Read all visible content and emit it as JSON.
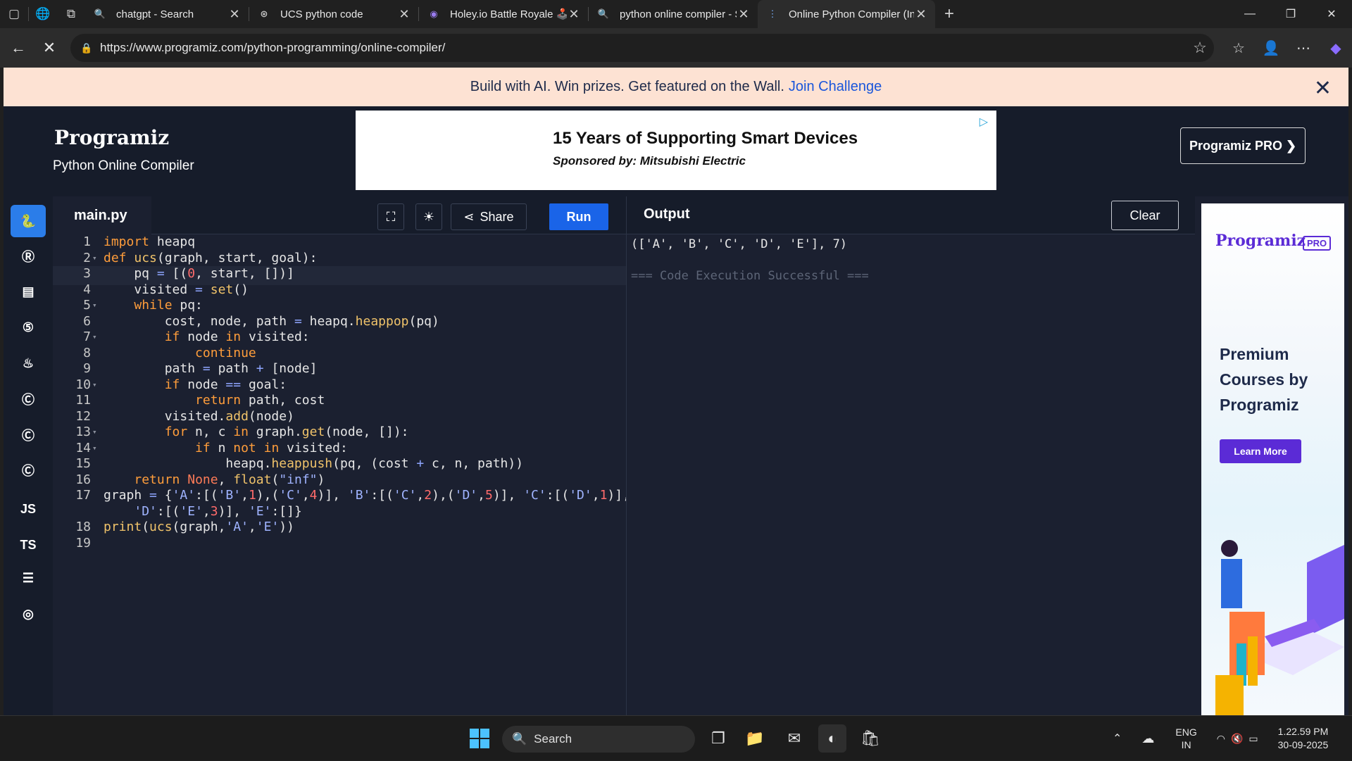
{
  "browser": {
    "tabs": [
      {
        "title": "chatgpt - Search",
        "icon": "search-icon"
      },
      {
        "title": "UCS python code",
        "icon": "chatgpt-icon"
      },
      {
        "title": "Holey.io Battle Royale 🕹️ Play or",
        "icon": "game-icon"
      },
      {
        "title": "python online compiler - Search",
        "icon": "search-icon"
      },
      {
        "title": "Online Python Compiler (Interpre",
        "icon": "loading-icon"
      }
    ],
    "url": "https://www.programiz.com/python-programming/online-compiler/"
  },
  "banner": {
    "text": "Build with AI. Win prizes. Get featured on the Wall.",
    "link": "Join Challenge"
  },
  "header": {
    "logo": "Programiz",
    "subtitle": "Python Online Compiler",
    "pro_button": "Programiz PRO ❯"
  },
  "ad": {
    "title": "15 Years of Supporting Smart Devices",
    "sponsor": "Sponsored by: Mitsubishi Electric"
  },
  "rail": {
    "items": [
      "python-icon",
      "r-icon",
      "sql-icon",
      "html-icon",
      "java-icon",
      "c-icon",
      "cpp-icon",
      "csharp-icon",
      "JS",
      "TS",
      "go-icon",
      "swift-icon"
    ]
  },
  "editor": {
    "filename": "main.py",
    "share_label": "Share",
    "run_label": "Run",
    "lines": [
      "import heapq",
      "def ucs(graph, start, goal):",
      "    pq = [(0, start, [])]",
      "    visited = set()",
      "    while pq:",
      "        cost, node, path = heapq.heappop(pq)",
      "        if node in visited:",
      "            continue",
      "        path = path + [node]",
      "        if node == goal:",
      "            return path, cost",
      "        visited.add(node)",
      "        for n, c in graph.get(node, []):",
      "            if n not in visited:",
      "                heapq.heappush(pq, (cost + c, n, path))",
      "    return None, float(\"inf\")",
      "graph = {'A':[('B',1),('C',4)], 'B':[('C',2),('D',5)], 'C':[('D',1)],",
      "    'D':[('E',3)], 'E':[]}",
      "print(ucs(graph,'A','E'))",
      ""
    ],
    "line_numbers": [
      "1",
      "2",
      "3",
      "4",
      "5",
      "6",
      "7",
      "8",
      "9",
      "10",
      "11",
      "12",
      "13",
      "14",
      "15",
      "16",
      "17",
      "",
      "18",
      "19"
    ]
  },
  "output": {
    "title": "Output",
    "clear_label": "Clear",
    "result": "(['A', 'B', 'C', 'D', 'E'], 7)",
    "status": "=== Code Execution Successful ==="
  },
  "side_ad": {
    "logo": "Programiz",
    "badge": "PRO",
    "text": "Premium Courses by Programiz",
    "button": "Learn More"
  },
  "taskbar": {
    "search_placeholder": "Search",
    "lang": "ENG",
    "region": "IN",
    "time": "1.22.59 PM",
    "date": "30-09-2025"
  }
}
